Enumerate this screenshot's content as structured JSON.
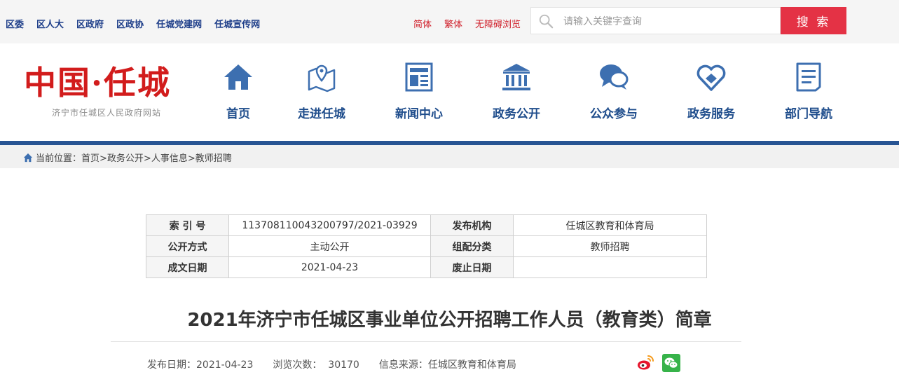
{
  "topbar": {
    "links": [
      "区委",
      "区人大",
      "区政府",
      "区政协",
      "任城党建网",
      "任城宣传网"
    ],
    "lang": [
      "简体",
      "繁体",
      "无障碍浏览"
    ],
    "search_placeholder": "请输入关键字查询",
    "search_button": "搜 索"
  },
  "header": {
    "logo_title": "中国·任城",
    "logo_subtitle": "济宁市任城区人民政府网站",
    "nav": [
      "首页",
      "走进任城",
      "新闻中心",
      "政务公开",
      "公众参与",
      "政务服务",
      "部门导航"
    ]
  },
  "breadcrumb": {
    "prefix": "当前位置：",
    "items": [
      "首页>",
      "政务公开>",
      "人事信息>",
      "教师招聘"
    ]
  },
  "info_table": {
    "rows": [
      [
        "索 引 号",
        "11370811004320079​7/2021-03929",
        "发布机构",
        "任城区教育和体育局"
      ],
      [
        "公开方式",
        "主动公开",
        "组配分类",
        "教师招聘"
      ],
      [
        "成文日期",
        "2021-04-23",
        "废止日期",
        ""
      ]
    ]
  },
  "article": {
    "title": "2021年济宁市任城区事业单位公开招聘工作人员（教育类）简章",
    "publish_date": "发布日期：2021-04-23",
    "views_label": "浏览次数：",
    "views": "30170",
    "source": "信息来源：任城区教育和体育局"
  },
  "colors": {
    "nav_blue": "#1f4d8c",
    "accent_red": "#e43245",
    "rule_blue": "#275493"
  },
  "icons": [
    "search-icon",
    "home-icon",
    "news-icon",
    "government-icon",
    "chat-icon",
    "service-icon",
    "directory-icon",
    "weibo-icon",
    "wechat-icon"
  ]
}
